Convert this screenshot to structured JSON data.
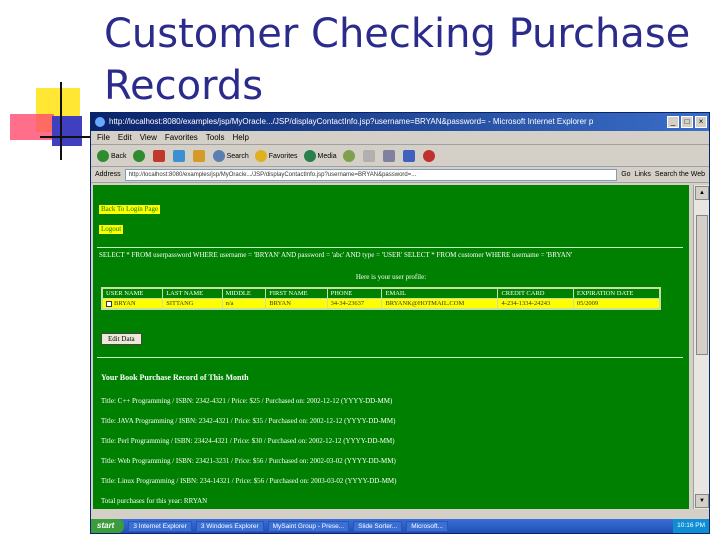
{
  "slide": {
    "title_line1": "Customer Checking Purchase",
    "title_line2": "Records"
  },
  "window": {
    "title": "http://localhost:8080/examples/jsp/MyOracle.../JSP/displayContactInfo.jsp?username=BRYAN&password= - Microsoft Internet Explorer p",
    "min": "_",
    "max": "□",
    "close": "×"
  },
  "menu": {
    "file": "File",
    "edit": "Edit",
    "view": "View",
    "favorites": "Favorites",
    "tools": "Tools",
    "help": "Help"
  },
  "toolbar": {
    "back": "Back",
    "search": "Search",
    "favorites": "Favorites",
    "media": "Media"
  },
  "address": {
    "label": "Address",
    "url": "http://localhost:8080/examples/jsp/MyOracle.../JSP/displayContactInfo.jsp?username=BRYAN&password=...",
    "go": "Go",
    "links": "Links",
    "search_web": "Search the Web"
  },
  "page": {
    "back_link": "Back To Login Page",
    "logout_link": "Logout",
    "sql_text": "SELECT * FROM userpassword WHERE username = 'BRYAN' AND password = 'abc' AND type = 'USER' SELECT * FROM customer WHERE username = 'BRYAN'",
    "profile_caption": "Here is your user profile:",
    "table": {
      "headers": [
        "USER NAME",
        "LAST NAME",
        "MIDDLE",
        "FIRST NAME",
        "PHONE",
        "EMAIL",
        "CREDIT CARD",
        "EXPIRATION DATE"
      ],
      "row": [
        "BRYAN",
        "SITTANG",
        "n/a",
        "BRYAN",
        "34-34-23637",
        "BRYANK@HOTMAIL.COM",
        "4-234-1334-24243",
        "05/2009"
      ]
    },
    "edit_button": "Edit Data",
    "purchase_heading": "Your Book Purchase Record of This Month",
    "purchases": [
      "Title: C++ Programming / ISBN: 2342-4321 / Price: $25 / Purchased on: 2002-12-12 (YYYY-DD-MM)",
      "Title: JAVA Programming / ISBN: 2342-4321 / Price: $35 / Purchased on: 2002-12-12 (YYYY-DD-MM)",
      "Title: Perl Programming / ISBN: 23424-4321 / Price: $30 / Purchased on: 2002-12-12 (YYYY-DD-MM)",
      "Title: Web Programming / ISBN: 23421-3231 / Price: $56 / Purchased on: 2002-03-02 (YYYY-DD-MM)",
      "Title: Linux Programming / ISBN: 234-14321 / Price: $56 / Purchased on: 2003-03-02 (YYYY-DD-MM)",
      "Total purchases for this year: RRYAN"
    ]
  },
  "taskbar": {
    "start": "start",
    "tasks": [
      "3 Internet Explorer",
      "3 Windows Explorer",
      "MySaint Group - Prese...",
      "Slide Sorter...",
      "Microsoft..."
    ],
    "tray": "10:16 PM"
  },
  "colors": {
    "page_bg": "#008000",
    "highlight": "#ffff00",
    "title": "#2b2b8c"
  }
}
